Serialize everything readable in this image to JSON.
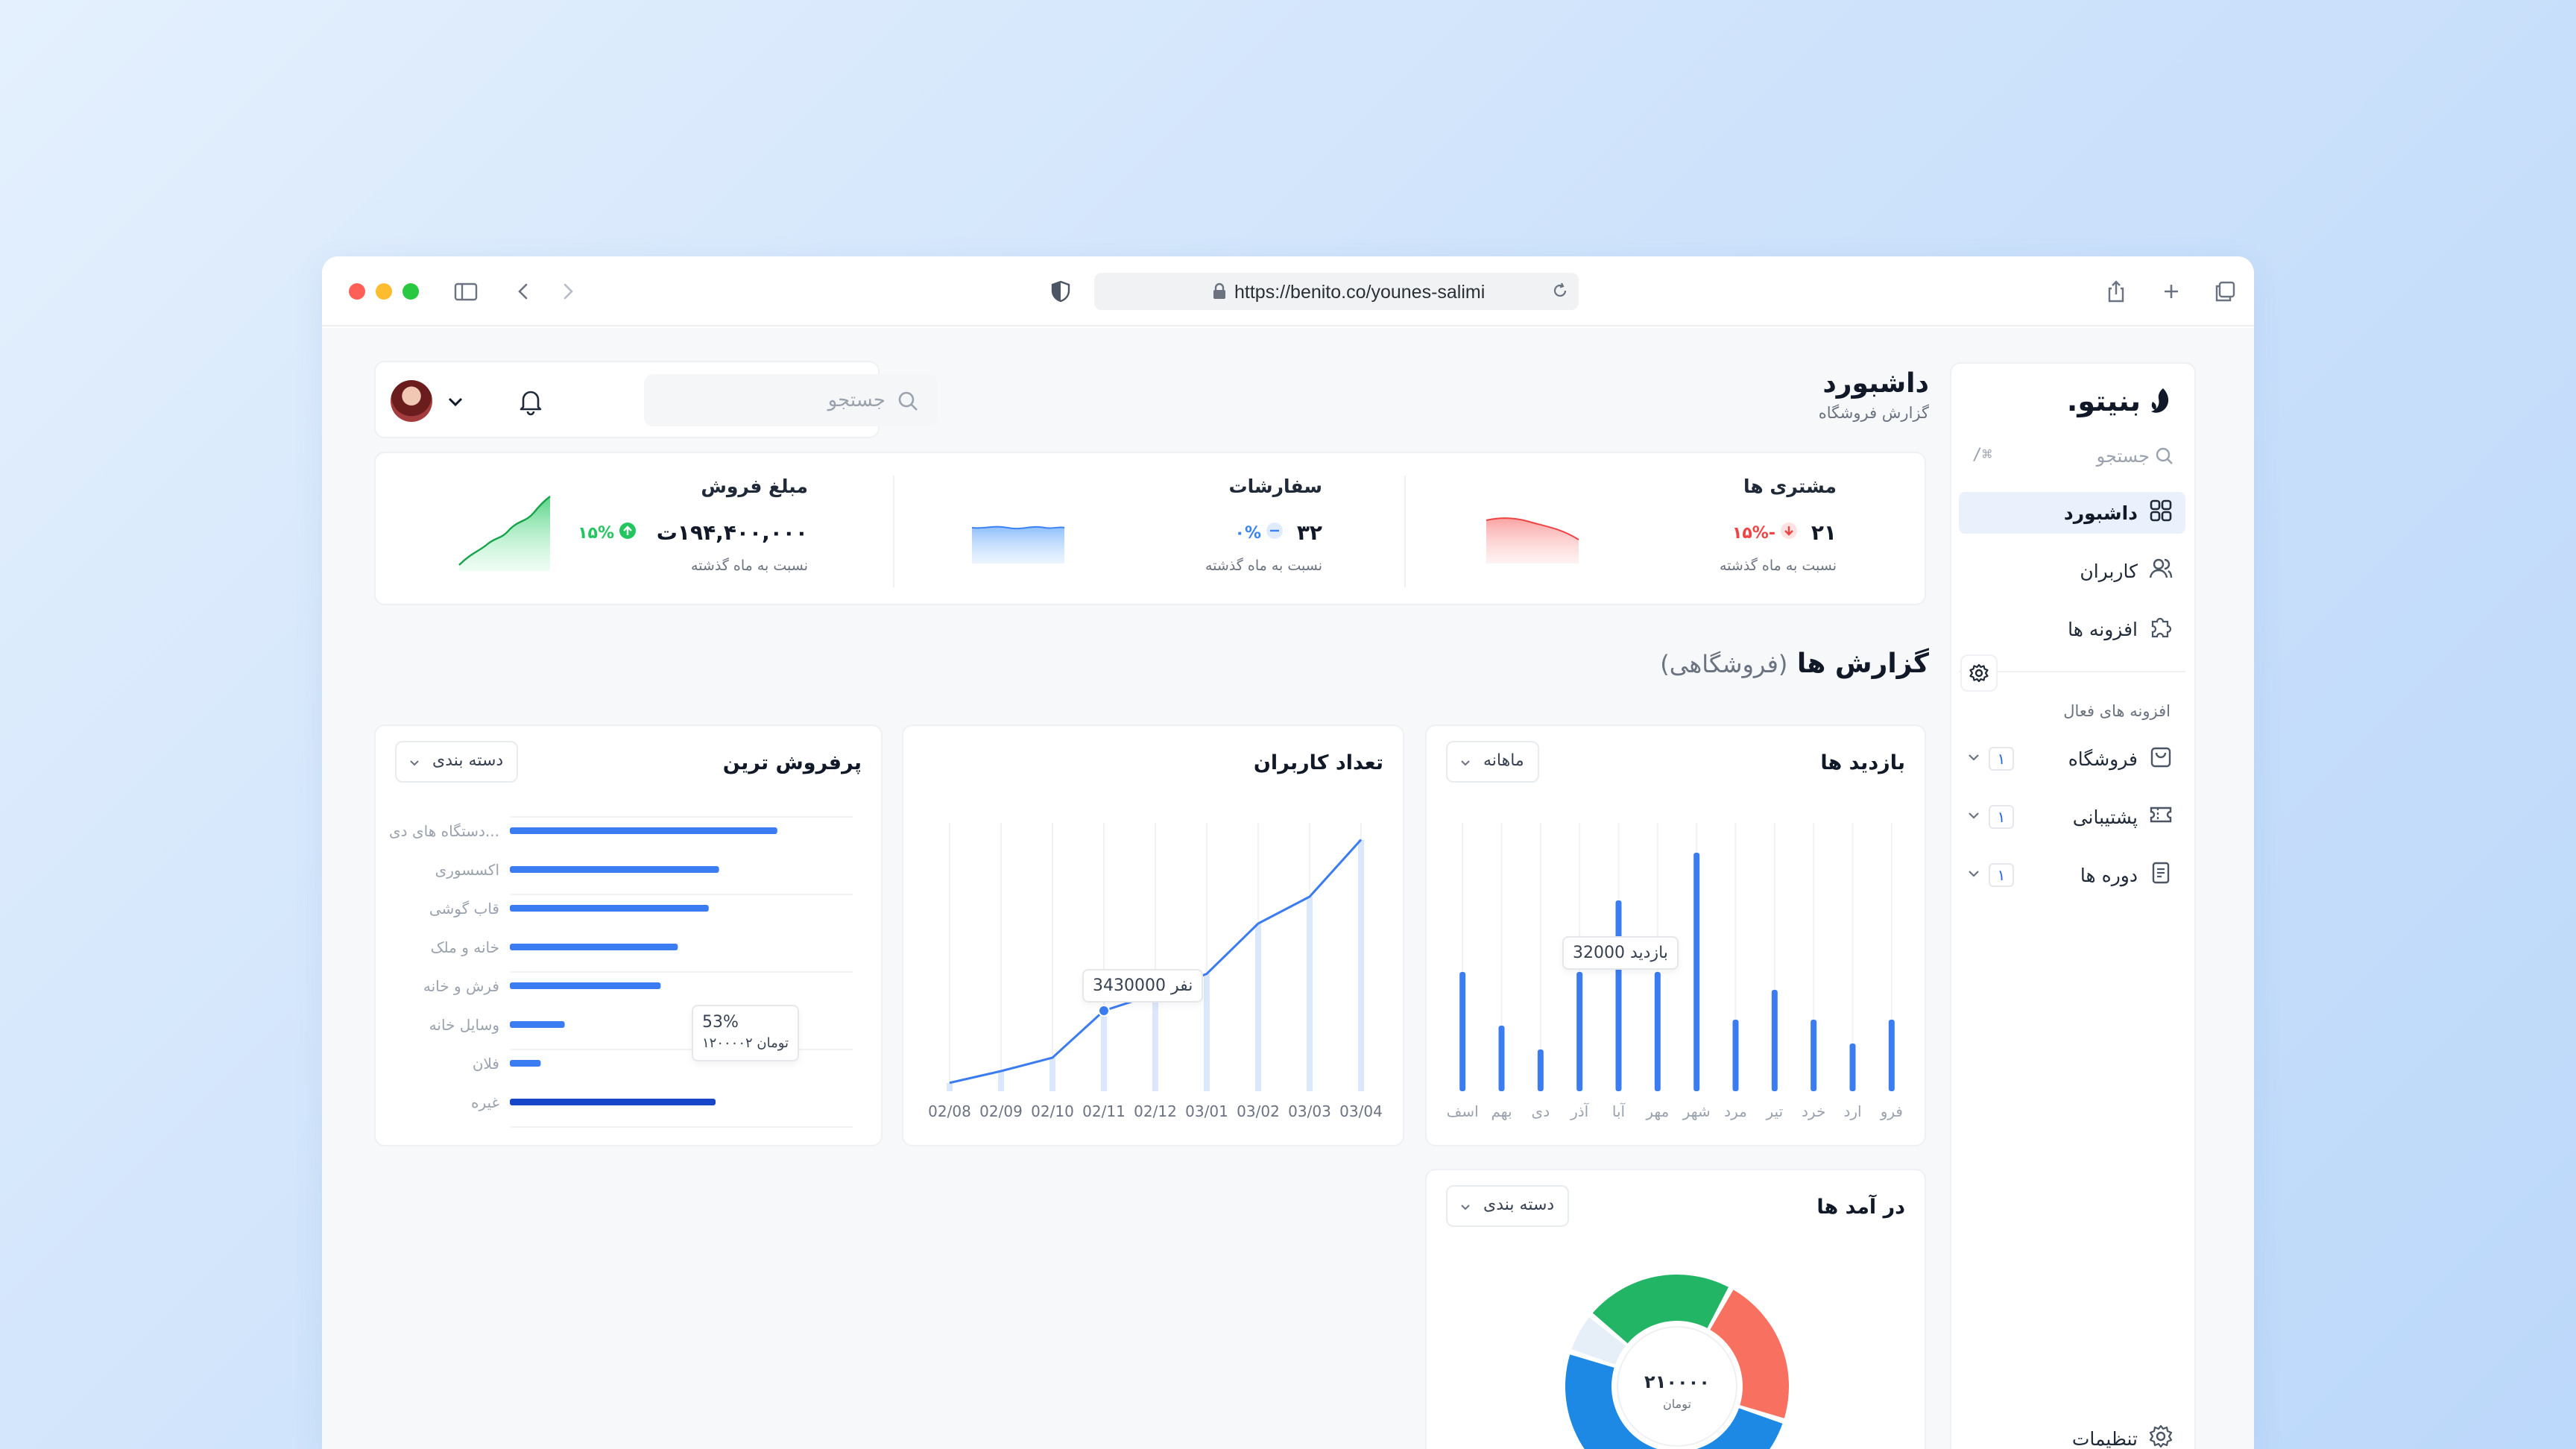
{
  "browser": {
    "url": "https://benito.co/younes-salimi",
    "traffic_lights": [
      "#ff5f57",
      "#febc2e",
      "#28c840"
    ]
  },
  "brand": {
    "name": "بنیتو."
  },
  "sidebar": {
    "search_placeholder": "جستجو",
    "search_shortcut": "⌘/",
    "items": [
      {
        "label": "داشبورد",
        "icon": "grid-icon",
        "active": true
      },
      {
        "label": "کاربران",
        "icon": "users-icon",
        "active": false
      },
      {
        "label": "افزونه ها",
        "icon": "puzzle-icon",
        "active": false
      }
    ],
    "section_title": "افزونه های فعال",
    "plugins": [
      {
        "label": "فروشگاه",
        "count": "۱",
        "icon": "shopping-bag-icon"
      },
      {
        "label": "پشتیبانی",
        "count": "۱",
        "icon": "ticket-icon"
      },
      {
        "label": "دوره ها",
        "count": "۱",
        "icon": "document-icon"
      }
    ],
    "settings_label": "تنظیمات"
  },
  "header": {
    "title": "داشبورد",
    "subtitle": "گزارش فروشگاه",
    "search_placeholder": "جستجو"
  },
  "stats": [
    {
      "title": "مشتری ها",
      "value": "۲۱",
      "change": "-۱۵%",
      "direction": "down",
      "compare": "نسبت به ماه گذشته",
      "color": "#ef4444"
    },
    {
      "title": "سفارشات",
      "value": "۳۲",
      "change": "۰%",
      "direction": "flat",
      "compare": "نسبت به ماه گذشته",
      "color": "#3b82f6"
    },
    {
      "title": "مبلغ فروش",
      "value": "۱۹۴,۴۰۰,۰۰۰ت",
      "change": "۱۵%",
      "direction": "up",
      "compare": "نسبت به ماه گذشته",
      "color": "#22c55e"
    }
  ],
  "reports": {
    "title": "گزارش ها",
    "scope": "(فروشگاهی)"
  },
  "visits_chart": {
    "title": "بازدید ها",
    "filter": "ماهانه",
    "tooltip": "32000 بازدید",
    "chart_data": {
      "type": "bar",
      "categories": [
        "فرو",
        "ارد",
        "خرد",
        "تیر",
        "مرد",
        "شهر",
        "مهر",
        "آبا",
        "آذر",
        "دی",
        "بهم",
        "اسف"
      ],
      "values": [
        12,
        8,
        12,
        17,
        12,
        40,
        20,
        32,
        20,
        7,
        11,
        20
      ],
      "highlight_index": 7,
      "ylim": [
        0,
        45
      ]
    }
  },
  "users_chart": {
    "title": "تعداد کاربران",
    "tooltip": "3430000 نفر",
    "chart_data": {
      "type": "line",
      "x": [
        "02/08",
        "02/09",
        "02/10",
        "02/11",
        "02/12",
        "03/01",
        "03/02",
        "03/03",
        "03/04"
      ],
      "values": [
        5,
        12,
        20,
        48,
        58,
        70,
        100,
        116,
        150
      ],
      "highlight_index": 3,
      "ylim": [
        0,
        160
      ]
    }
  },
  "bestsellers_chart": {
    "title": "پرفروش ترین",
    "filter": "دسته بندی",
    "tooltip": {
      "percent": "53%",
      "amount": "۱۲۰۰۰۰۲ تومان"
    },
    "chart_data": {
      "type": "bar",
      "orientation": "horizontal",
      "categories": [
        "دستگاه های دی...",
        "اکسسوری",
        "قاب گوشی",
        "خانه و ملک",
        "فرش و خانه",
        "وسایل خانه",
        "فلان",
        "غیره"
      ],
      "values": [
        78,
        61,
        58,
        49,
        44,
        16,
        9,
        60
      ],
      "highlight_index": 7,
      "xlim": [
        0,
        100
      ]
    }
  },
  "income_chart": {
    "title": "در آمد ها",
    "filter": "دسته بندی",
    "center_value": "۲۱۰۰۰۰",
    "center_unit": "تومان",
    "chart_data": {
      "type": "pie",
      "slices": [
        {
          "value": 30,
          "color": "#1e88e5"
        },
        {
          "value": 6,
          "color": "#e6eef8"
        },
        {
          "value": 22,
          "color": "#22b566"
        },
        {
          "value": 22,
          "color": "#f87060"
        },
        {
          "value": 20,
          "color": "#1e88e5"
        }
      ]
    }
  }
}
